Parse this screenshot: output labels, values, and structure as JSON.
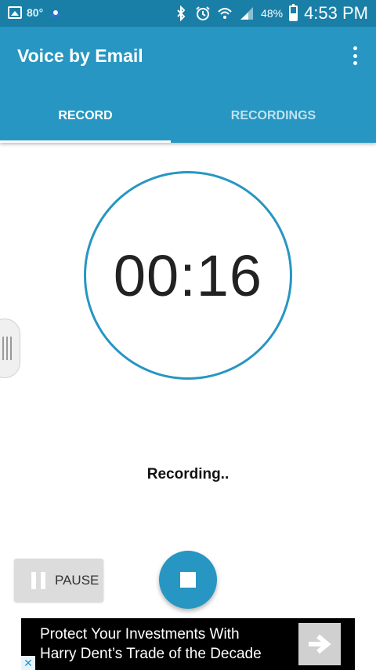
{
  "status_bar": {
    "temperature": "80°",
    "battery_percent": "48%",
    "battery_level": 0.48,
    "time": "4:53 PM",
    "icons": [
      "gallery-icon",
      "weather-icon",
      "bluetooth-icon",
      "alarm-icon",
      "wifi-icon",
      "signal-icon",
      "battery-icon"
    ]
  },
  "app_bar": {
    "title": "Voice by Email",
    "menu_icon": "overflow-menu-icon"
  },
  "tabs": [
    {
      "label": "RECORD",
      "selected": true
    },
    {
      "label": "RECORDINGS",
      "selected": false
    }
  ],
  "timer": {
    "value": "00:16"
  },
  "recording_status": "Recording..",
  "controls": {
    "pause_label": "PAUSE",
    "stop_icon": "stop-icon"
  },
  "ad": {
    "line1": "Protect Your Investments With",
    "line2": "Harry Dent’s Trade of the Decade",
    "arrow_icon": "arrow-right-icon",
    "choices_icon": "ad-choices-icon"
  },
  "colors": {
    "status_bar": "#1a7fa6",
    "primary": "#2796c2",
    "tab_inactive": "#bfe2f0"
  }
}
